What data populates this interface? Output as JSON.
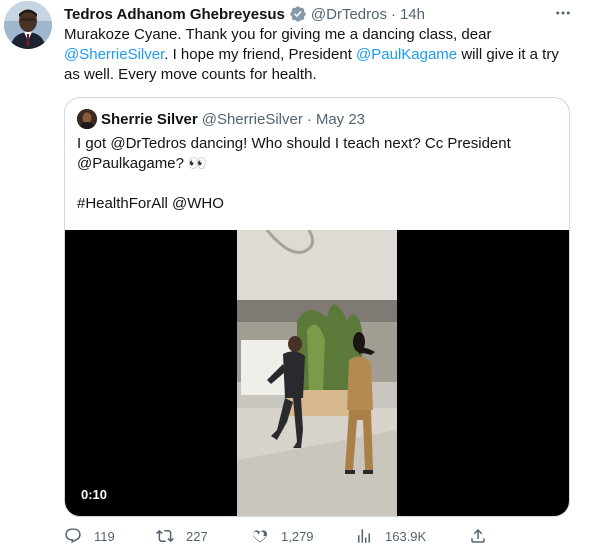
{
  "tweet": {
    "author": {
      "name": "Tedros Adhanom Ghebreyesus",
      "handle": "@DrTedros",
      "separator": "·",
      "time": "14h",
      "verified_icon": "verified-badge-icon"
    },
    "text": {
      "part1": "Murakoze Cyane. Thank you for giving me a dancing class, dear ",
      "mention1": "@SherrieSilver",
      "part2": ". I hope my friend, President ",
      "mention2": "@PaulKagame",
      "part3": " will give it a try as well. Every move counts for health."
    },
    "more_icon": "more-options-icon"
  },
  "quoted_tweet": {
    "author": {
      "name": "Sherrie Silver",
      "handle": "@SherrieSilver",
      "separator": "·",
      "time": "May 23"
    },
    "lines": [
      "I got @DrTedros dancing! Who should I teach next? Cc President",
      "@Paulkagame? 👀",
      "",
      "#HealthForAll @WHO"
    ],
    "video": {
      "duration": "0:10"
    }
  },
  "actions": {
    "reply_count": "119",
    "retweet_count": "227",
    "like_count": "1,279",
    "views_count": "163.9K",
    "icons": [
      "reply-icon",
      "retweet-icon",
      "like-icon",
      "views-icon",
      "share-icon"
    ]
  },
  "colors": {
    "accent": "#1d9bf0",
    "text_primary": "#0f1419",
    "text_secondary": "#536471",
    "border": "#cfd9de"
  }
}
